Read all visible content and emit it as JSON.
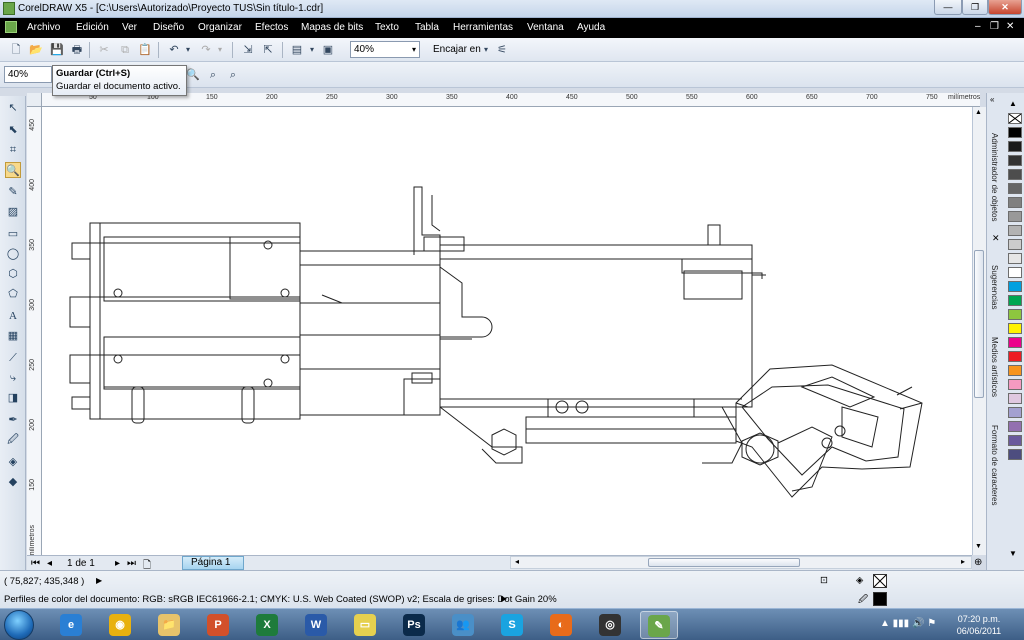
{
  "window": {
    "title": "CorelDRAW X5 - [C:\\Users\\Autorizado\\Proyecto TUS\\Sin título-1.cdr]",
    "controls": [
      "minimize-icon",
      "restore-icon",
      "close-icon"
    ]
  },
  "menu": [
    "Archivo",
    "Edición",
    "Ver",
    "Diseño",
    "Organizar",
    "Efectos",
    "Mapas de bits",
    "Texto",
    "Tabla",
    "Herramientas",
    "Ventana",
    "Ayuda"
  ],
  "toolbar": {
    "zoom_value": "40%",
    "fit_label": "Encajar en",
    "icons": [
      "new-icon",
      "open-icon",
      "save-icon",
      "print-icon",
      "cut-icon",
      "copy-icon",
      "paste-icon",
      "undo-icon",
      "redo-icon",
      "import-icon",
      "export-icon",
      "publish-pdf-icon",
      "app-launcher-icon",
      "snap-icon"
    ]
  },
  "toolbar2": {
    "zoom_value": "40%",
    "tooltip_title": "Guardar (Ctrl+S)",
    "tooltip_desc": "Guardar el documento activo."
  },
  "ruler": {
    "unit": "milímetros",
    "h_ticks": [
      "50",
      "100",
      "150",
      "200",
      "250",
      "300",
      "350",
      "400",
      "450",
      "500",
      "550",
      "600",
      "650",
      "700",
      "750"
    ],
    "v_ticks": [
      "450",
      "400",
      "350",
      "300",
      "250",
      "200",
      "150"
    ]
  },
  "pages": {
    "counter": "1 de 1",
    "tab": "Página 1"
  },
  "dockers": [
    "Administrador de objetos",
    "Sugerencias",
    "Medios artísticos",
    "Formato de caracteres"
  ],
  "palette": [
    "#ffffff",
    "#000000",
    "#1a1a1a",
    "#333333",
    "#4d4d4d",
    "#666666",
    "#808080",
    "#999999",
    "#b3b3b3",
    "#cccccc",
    "#e6e6e6",
    "#ffffff",
    "#00a0e0",
    "#00a651",
    "#8dc63f",
    "#fff200",
    "#ec008c",
    "#ed1c24",
    "#f7941d",
    "#f49ac1",
    "#e0c8e0",
    "#a3a0d0",
    "#9370b0",
    "#6a5a9c",
    "#4d4d7f"
  ],
  "status": {
    "coords": "( 75,827; 435,348 )",
    "color_profiles": "Perfiles de color del documento: RGB: sRGB IEC61966-2.1; CMYK: U.S. Web Coated (SWOP) v2; Escala de grises: Dot Gain 20%"
  },
  "taskbar": {
    "apps": [
      "Internet Explorer",
      "Chrome",
      "Explorer",
      "PowerPoint",
      "Excel",
      "Word",
      "Notes",
      "Photoshop",
      "People",
      "Skype",
      "Firefox",
      "CorelDRAW Graphics",
      "CorelDRAW"
    ],
    "time": "07:20 p.m.",
    "date": "06/06/2011"
  }
}
